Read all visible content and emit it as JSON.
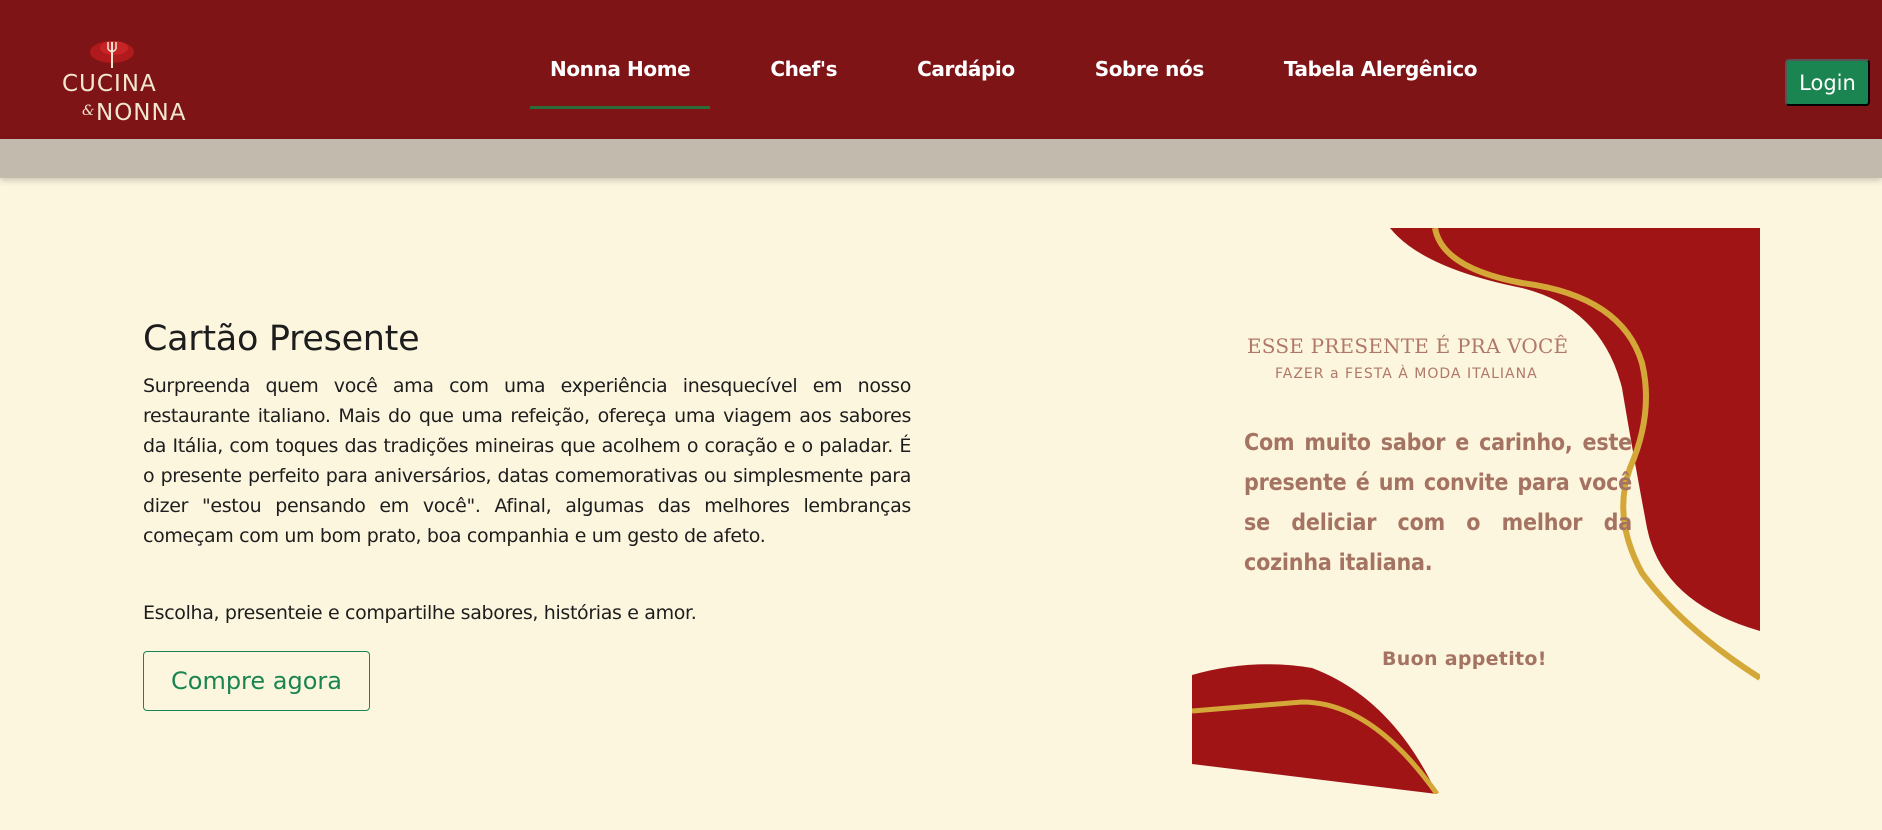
{
  "brand": {
    "logo_line1": "CUCINA",
    "logo_amp": "&",
    "logo_line2": "NONNA",
    "colors": {
      "primary": "#7f1416",
      "accent_green": "#1a8550",
      "background": "#fdf6df",
      "band": "#c2bbad"
    }
  },
  "nav": {
    "items": [
      {
        "label": "Nonna Home",
        "active": true
      },
      {
        "label": "Chef's",
        "active": false
      },
      {
        "label": "Cardápio",
        "active": false
      },
      {
        "label": "Sobre nós",
        "active": false
      },
      {
        "label": "Tabela Alergênico",
        "active": false
      }
    ],
    "login_label": "Login"
  },
  "gift": {
    "title": "Cartão Presente",
    "description": "Surpreenda quem você ama com uma experiência inesquecível em nosso restaurante italiano. Mais do que uma refeição, ofereça uma viagem aos sabores da Itália, com toques das tradições mineiras que acolhem o coração e o paladar. É o presente perfeito para aniversários, datas comemorativas ou simplesmente para dizer \"estou pensando em você\". Afinal, algumas das melhores lembranças começam com um bom prato, boa companhia e um gesto de afeto.",
    "tagline": "Escolha, presenteie e compartilhe sabores, histórias e amor.",
    "button_label": "Compre agora"
  },
  "card": {
    "heading": "ESSE PRESENTE É PRA VOCÊ",
    "subheading": "FAZER a FESTA À MODA ITALIANA",
    "message": "Com muito sabor e carinho, este presente é um convite para você se deliciar com o melhor da cozinha italiana.",
    "closing": "Buon appetito!",
    "colors": {
      "red": "#a01416",
      "gold": "#d4a838",
      "text": "#a57362"
    }
  }
}
